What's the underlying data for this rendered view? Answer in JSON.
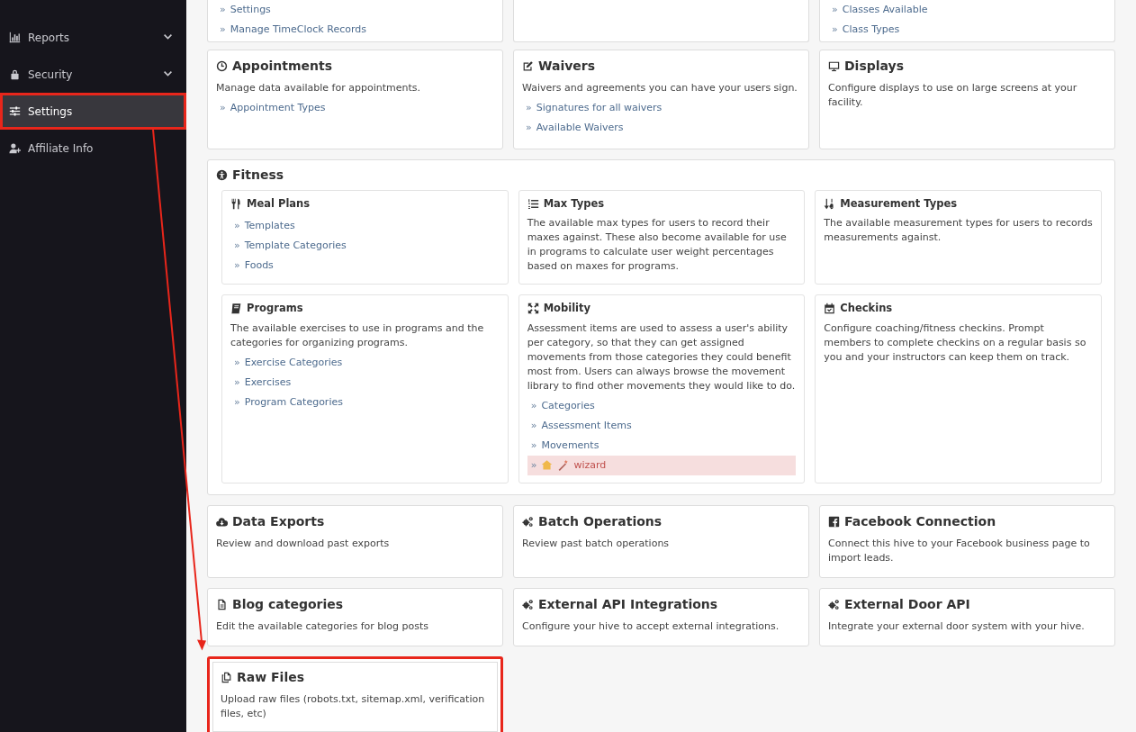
{
  "sidebar": {
    "items": [
      {
        "label": "Reports",
        "expandable": true,
        "selected": false,
        "highlighted": false
      },
      {
        "label": "Security",
        "expandable": true,
        "selected": false,
        "highlighted": false
      },
      {
        "label": "Settings",
        "expandable": false,
        "selected": true,
        "highlighted": true
      },
      {
        "label": "Affiliate Info",
        "expandable": false,
        "selected": false,
        "highlighted": false
      }
    ]
  },
  "top_cards": [
    {
      "kind": "links",
      "links": [
        {
          "marker": "»",
          "label": "Settings"
        },
        {
          "marker": "»",
          "label": "Manage TimeClock Records"
        }
      ]
    },
    {
      "kind": "blank"
    },
    {
      "kind": "links",
      "links": [
        {
          "marker": "»",
          "label": "Classes Available"
        },
        {
          "marker": "»",
          "label": "Class Types"
        }
      ]
    }
  ],
  "cards": [
    {
      "title": "Appointments",
      "description": "Manage data available for appointments.",
      "links": [
        {
          "marker": "»",
          "label": "Appointment Types"
        }
      ]
    },
    {
      "title": "Waivers",
      "description": "Waivers and agreements you can have your users sign.",
      "links": [
        {
          "marker": "»",
          "label": "Signatures for all waivers"
        },
        {
          "marker": "»",
          "label": "Available Waivers"
        }
      ]
    },
    {
      "title": "Displays",
      "description": "Configure displays to use on large screens at your facility."
    }
  ],
  "fitness": {
    "title": "Fitness",
    "sections": [
      {
        "title": "Meal Plans",
        "links": [
          {
            "marker": "»",
            "label": "Templates"
          },
          {
            "marker": "»",
            "label": "Template Categories"
          },
          {
            "marker": "»",
            "label": "Foods"
          }
        ]
      },
      {
        "title": "Max Types",
        "description": "The available max types for users to record their maxes against. These also become available for use in programs to calculate user weight percentages based on maxes for programs."
      },
      {
        "title": "Measurement Types",
        "description": "The available measurement types for users to records measurements against."
      },
      {
        "title": "Programs",
        "description": "The available exercises to use in programs and the categories for organizing programs.",
        "links": [
          {
            "marker": "»",
            "label": "Exercise Categories"
          },
          {
            "marker": "»",
            "label": "Exercises"
          },
          {
            "marker": "»",
            "label": "Program Categories"
          }
        ]
      },
      {
        "title": "Mobility",
        "description": "Assessment items are used to assess a user's ability per category, so that they can get assigned movements from those categories they could benefit most from. Users can always browse the movement library to find other movements they would like to do.",
        "links": [
          {
            "marker": "»",
            "label": "Categories",
            "highlighted": false
          },
          {
            "marker": "»",
            "label": "Assessment Items",
            "highlighted": false
          },
          {
            "marker": "»",
            "label": "Movements",
            "highlighted": false
          },
          {
            "marker": "»",
            "label": "wizard",
            "highlighted": true
          }
        ]
      },
      {
        "title": "Checkins",
        "description": "Configure coaching/fitness checkins. Prompt members to complete checkins on a regular basis so you and your instructors can keep them on track."
      }
    ]
  },
  "bottom_cards": [
    {
      "title": "Data Exports",
      "description": "Review and download past exports",
      "highlighted": false
    },
    {
      "title": "Batch Operations",
      "description": "Review past batch operations",
      "highlighted": false
    },
    {
      "title": "Facebook Connection",
      "description": "Connect this hive to your Facebook business page to import leads.",
      "highlighted": false
    },
    {
      "title": "Blog categories",
      "description": "Edit the available categories for blog posts",
      "highlighted": false
    },
    {
      "title": "External API Integrations",
      "description": "Configure your hive to accept external integrations.",
      "highlighted": false
    },
    {
      "title": "External Door API",
      "description": "Integrate your external door system with your hive.",
      "highlighted": false
    },
    {
      "title": "Raw Files",
      "description": "Upload raw files (robots.txt, sitemap.xml, verification files, etc)",
      "highlighted": true
    }
  ]
}
